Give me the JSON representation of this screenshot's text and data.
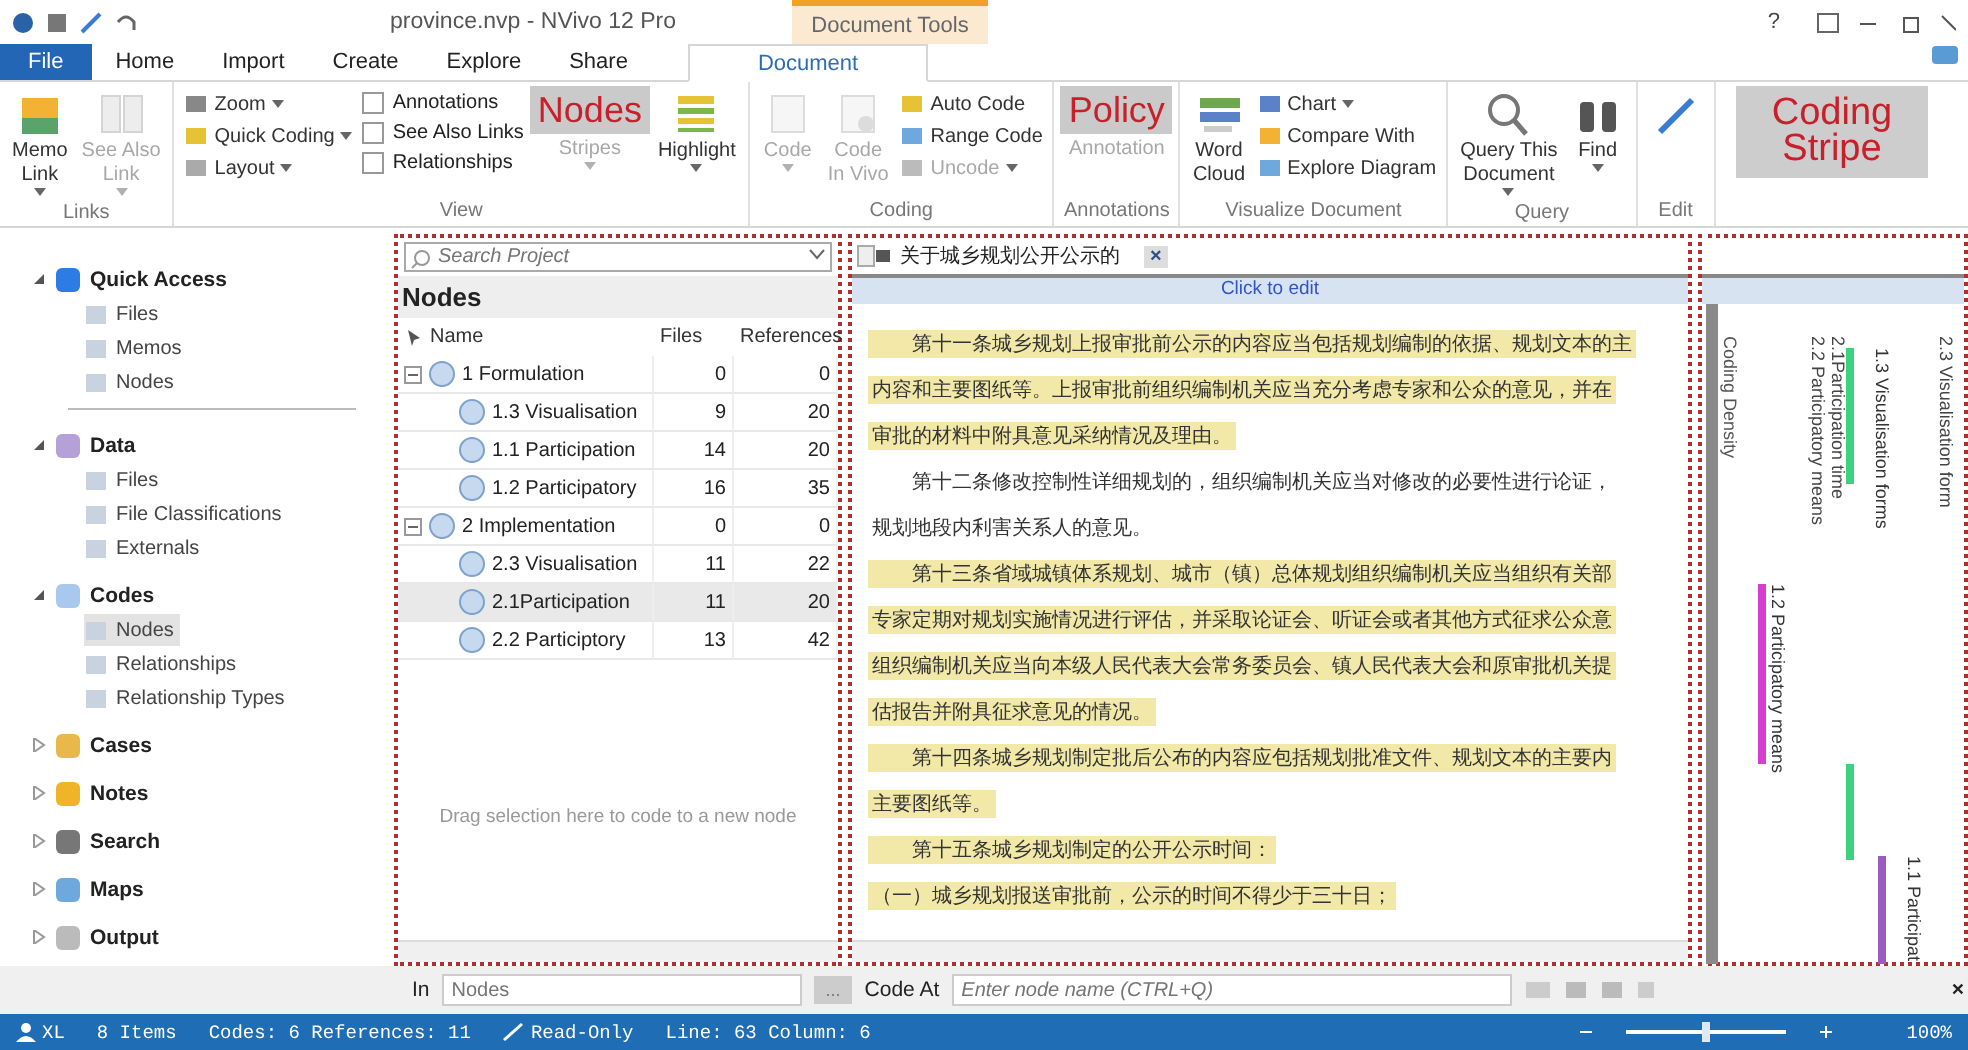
{
  "title_bar": {
    "title": "province.nvp - NVivo 12 Pro",
    "context_tab": "Document Tools",
    "help": "?"
  },
  "tabs": [
    {
      "label": "File",
      "kind": "file",
      "selected": false
    },
    {
      "label": "Home",
      "kind": "tab",
      "selected": false
    },
    {
      "label": "Import",
      "kind": "tab",
      "selected": false
    },
    {
      "label": "Create",
      "kind": "tab",
      "selected": false
    },
    {
      "label": "Explore",
      "kind": "tab",
      "selected": false
    },
    {
      "label": "Share",
      "kind": "tab",
      "selected": false
    },
    {
      "label": "Document",
      "kind": "context",
      "selected": true
    }
  ],
  "ribbon_groups": [
    {
      "label": "Links",
      "items": [
        {
          "kind": "large",
          "lines": [
            "Memo",
            "Link"
          ],
          "dropdown": true,
          "disabled": false
        },
        {
          "kind": "large",
          "lines": [
            "See Also",
            "Link"
          ],
          "dropdown": true,
          "disabled": true
        }
      ]
    },
    {
      "label": "View",
      "items": [
        {
          "kind": "small",
          "label": "Zoom",
          "dropdown": true,
          "disabled": false
        },
        {
          "kind": "small",
          "label": "Quick Coding",
          "dropdown": true,
          "disabled": false
        },
        {
          "kind": "small",
          "label": "Layout",
          "dropdown": true,
          "disabled": false
        },
        {
          "kind": "check",
          "label": "Annotations",
          "checked": false
        },
        {
          "kind": "check",
          "label": "See Also Links",
          "checked": false
        },
        {
          "kind": "check",
          "label": "Relationships",
          "checked": false
        },
        {
          "kind": "large",
          "lines": [
            "Stripes"
          ],
          "dropdown": true,
          "disabled": true
        },
        {
          "kind": "large",
          "lines": [
            "Highlight"
          ],
          "dropdown": true,
          "disabled": false
        }
      ]
    },
    {
      "label": "Coding",
      "items": [
        {
          "kind": "large",
          "lines": [
            "Code"
          ],
          "dropdown": true,
          "disabled": true
        },
        {
          "kind": "large",
          "lines": [
            "Code",
            "In Vivo"
          ],
          "dropdown": false,
          "disabled": true
        },
        {
          "kind": "small",
          "label": "Auto Code",
          "dropdown": false,
          "disabled": false
        },
        {
          "kind": "small",
          "label": "Range Code",
          "dropdown": false,
          "disabled": false
        },
        {
          "kind": "small",
          "label": "Uncode",
          "dropdown": true,
          "disabled": true
        }
      ]
    },
    {
      "label": "Annotations",
      "items": [
        {
          "kind": "large",
          "lines": [
            "Annotation"
          ],
          "dropdown": false,
          "disabled": true
        }
      ]
    },
    {
      "label": "Visualize Document",
      "items": [
        {
          "kind": "large",
          "lines": [
            "Word",
            "Cloud"
          ],
          "dropdown": false,
          "disabled": false
        },
        {
          "kind": "small",
          "label": "Chart",
          "dropdown": true,
          "disabled": false
        },
        {
          "kind": "small",
          "label": "Compare With",
          "dropdown": false,
          "disabled": false
        },
        {
          "kind": "small",
          "label": "Explore Diagram",
          "dropdown": false,
          "disabled": false
        }
      ]
    },
    {
      "label": "Query",
      "items": [
        {
          "kind": "large",
          "lines": [
            "Query This",
            "Document"
          ],
          "dropdown": true,
          "disabled": false
        },
        {
          "kind": "large",
          "lines": [
            "Find"
          ],
          "dropdown": true,
          "disabled": false
        }
      ]
    },
    {
      "label": "Edit",
      "items": [
        {
          "kind": "large",
          "dropdown": false,
          "disabled": false
        }
      ]
    }
  ],
  "callouts": [
    {
      "text": "Nodes"
    },
    {
      "text": "Policy"
    },
    {
      "text": "Coding Stripe"
    }
  ],
  "navigation": [
    {
      "label": "Quick Access",
      "expanded": true,
      "children": [
        {
          "label": "Files",
          "selected": false
        },
        {
          "label": "Memos",
          "selected": false
        },
        {
          "label": "Nodes",
          "selected": false
        }
      ]
    },
    {
      "label": "Data",
      "expanded": true,
      "children": [
        {
          "label": "Files",
          "selected": false
        },
        {
          "label": "File Classifications",
          "selected": false
        },
        {
          "label": "Externals",
          "selected": false
        }
      ]
    },
    {
      "label": "Codes",
      "expanded": true,
      "children": [
        {
          "label": "Nodes",
          "selected": true
        },
        {
          "label": "Relationships",
          "selected": false
        },
        {
          "label": "Relationship Types",
          "selected": false
        }
      ]
    },
    {
      "label": "Cases",
      "expanded": false
    },
    {
      "label": "Notes",
      "expanded": false
    },
    {
      "label": "Search",
      "expanded": false
    },
    {
      "label": "Maps",
      "expanded": false
    },
    {
      "label": "Output",
      "expanded": false
    }
  ],
  "nodes_panel": {
    "search": {
      "placeholder": "Search Project"
    },
    "title": "Nodes",
    "columns": [
      "Name",
      "Files",
      "References"
    ],
    "rows": [
      {
        "name": "1 Formulation",
        "files": "0",
        "references": "0",
        "expanded": true,
        "selected": false,
        "children": [
          {
            "name": "1.3 Visualisation",
            "files": "9",
            "references": "20",
            "selected": false
          },
          {
            "name": "1.1 Participation",
            "files": "14",
            "references": "20",
            "selected": false
          },
          {
            "name": "1.2 Participatory",
            "files": "16",
            "references": "35",
            "selected": false
          }
        ]
      },
      {
        "name": "2 Implementation",
        "files": "0",
        "references": "0",
        "expanded": true,
        "selected": false,
        "children": [
          {
            "name": "2.3 Visualisation",
            "files": "11",
            "references": "22",
            "selected": false
          },
          {
            "name": "2.1Participation",
            "files": "11",
            "references": "20",
            "selected": true
          },
          {
            "name": "2.2 Participtory",
            "files": "13",
            "references": "42",
            "selected": false
          }
        ]
      }
    ],
    "hint": "Drag selection here to code to a new node"
  },
  "document": {
    "tab": "关于城乡规划公开公示的",
    "close": "×",
    "edit_bar": "Click to edit",
    "lines": [
      {
        "text": "第十一条城乡规划上报审批前公示的内容应当包括规划编制的依据、规划文本的主",
        "coded": true,
        "indent": true
      },
      {
        "text": "内容和主要图纸等。上报审批前组织编制机关应当充分考虑专家和公众的意见，并在",
        "coded": true,
        "indent": false
      },
      {
        "text": "审批的材料中附具意见采纳情况及理由。",
        "coded": true,
        "indent": false
      },
      {
        "text": "第十二条修改控制性详细规划的，组织编制机关应当对修改的必要性进行论证，",
        "coded": false,
        "indent": true
      },
      {
        "text": "规划地段内利害关系人的意见。",
        "coded": false,
        "indent": false
      },
      {
        "text": "第十三条省域城镇体系规划、城市（镇）总体规划组织编制机关应当组织有关部",
        "coded": true,
        "indent": true
      },
      {
        "text": "专家定期对规划实施情况进行评估，并采取论证会、听证会或者其他方式征求公众意",
        "coded": true,
        "indent": false
      },
      {
        "text": "组织编制机关应当向本级人民代表大会常务委员会、镇人民代表大会和原审批机关提",
        "coded": true,
        "indent": false
      },
      {
        "text": "估报告并附具征求意见的情况。",
        "coded": true,
        "indent": false
      },
      {
        "text": "第十四条城乡规划制定批后公布的内容应包括规划批准文件、规划文本的主要内",
        "coded": true,
        "indent": true
      },
      {
        "text": "主要图纸等。",
        "coded": true,
        "indent": false
      },
      {
        "text": "第十五条城乡规划制定的公开公示时间：",
        "coded": true,
        "indent": true
      },
      {
        "text": "（一）城乡规划报送审批前，公示的时间不得少于三十日；",
        "coded": true,
        "indent": false
      }
    ]
  },
  "stripes": [
    {
      "label": "Coding Density",
      "kind": "density",
      "color": "#8a8a8a"
    },
    {
      "label": "1.2 Participatory  means",
      "kind": "stripe",
      "color": "#d43fd0"
    },
    {
      "label": "2.2 Participatory  means",
      "kind": "label"
    },
    {
      "label": "2.1Participation time",
      "kind": "label"
    },
    {
      "label": "1.3 Visualisation forms",
      "kind": "stripe",
      "color": "#3dd27e"
    },
    {
      "label": "1.1 Participat",
      "kind": "stripe",
      "color": "#9a5cc0"
    },
    {
      "label": "2.3 Visualisation form",
      "kind": "label"
    }
  ],
  "code_bar": {
    "in_label": "In",
    "in_field": {
      "placeholder": "Nodes"
    },
    "browse": "...",
    "code_at_label": "Code At",
    "node_field": {
      "placeholder": "Enter node name (CTRL+Q)"
    },
    "close": "×"
  },
  "status_bar": {
    "user": "XL",
    "items": "8 Items",
    "codes": "Codes: 6 References: 11",
    "mode": "Read-Only",
    "position": "Line: 63 Column: 6",
    "zoom": {
      "level": 0.5
    },
    "zoom_text": "100%"
  }
}
